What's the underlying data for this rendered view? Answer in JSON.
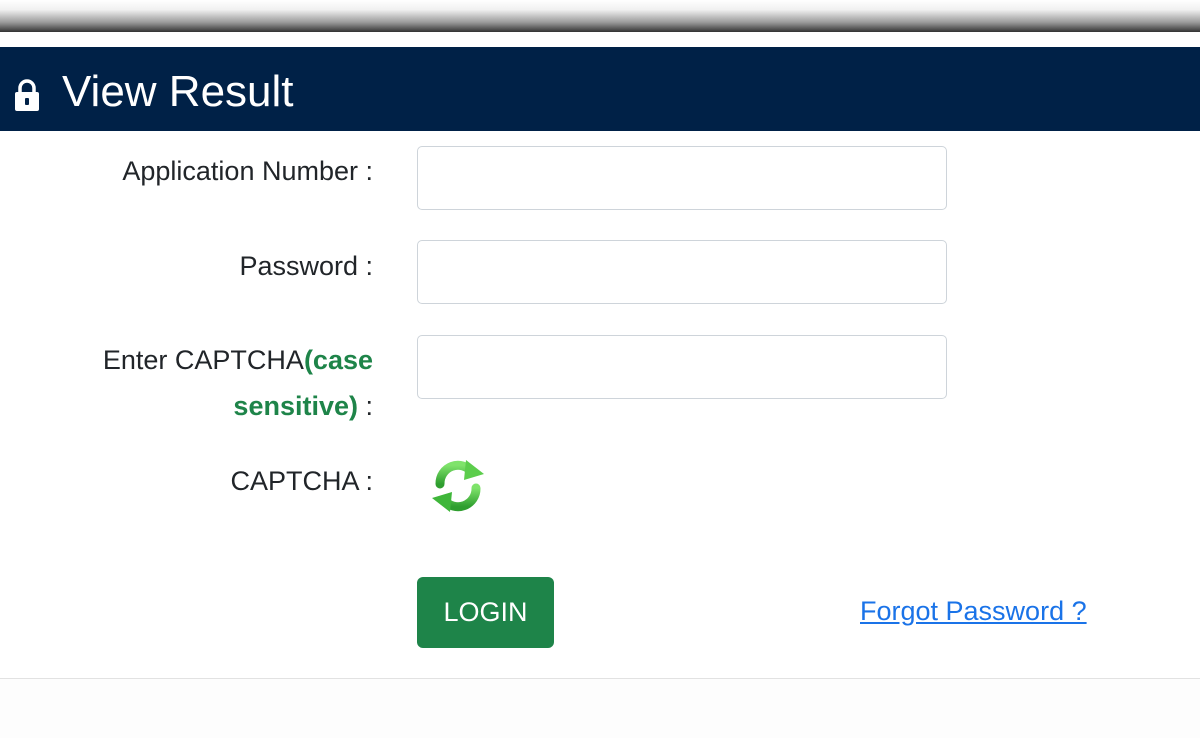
{
  "header": {
    "title": "View Result",
    "icon": "lock-icon",
    "background_color": "#002147"
  },
  "form": {
    "application_number_label": "Application Number :",
    "password_label": "Password :",
    "captcha_input_label_prefix": "Enter CAPTCHA",
    "captcha_input_label_highlight_1": "(case",
    "captcha_input_label_highlight_2": "sensitive)",
    "captcha_input_label_suffix": " :",
    "captcha_label": "CAPTCHA :",
    "application_number_value": "",
    "password_value": "",
    "captcha_value": "",
    "refresh_icon": "refresh-icon"
  },
  "actions": {
    "login_label": "LOGIN",
    "forgot_password_label": "Forgot Password ?"
  },
  "colors": {
    "accent_green": "#1e8449",
    "link_blue": "#1a73e8"
  }
}
